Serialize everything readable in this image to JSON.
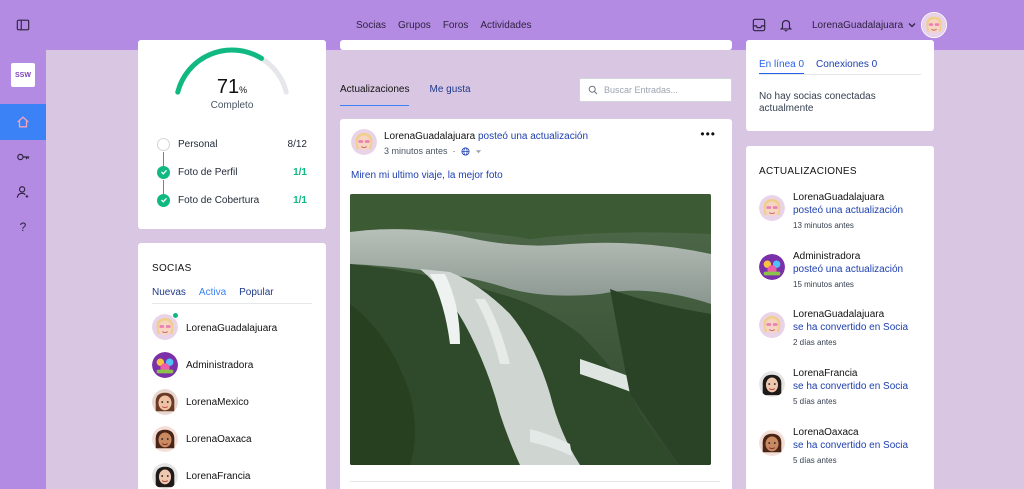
{
  "colors": {
    "accent": "#b48be3",
    "background": "#d9c6e3",
    "primary": "#3b82f6",
    "success": "#10b981"
  },
  "sidebar": {
    "logo_text": "SSW",
    "items": [
      {
        "icon": "sidebar-toggle-icon"
      },
      {
        "icon": "home-icon",
        "active": true
      },
      {
        "icon": "key-icon"
      },
      {
        "icon": "user-settings-icon"
      },
      {
        "icon": "help-icon",
        "text": "?"
      }
    ]
  },
  "topbar": {
    "nav": [
      "Socias",
      "Grupos",
      "Foros",
      "Actividades"
    ],
    "icons": [
      "inbox-icon",
      "bell-icon"
    ],
    "username": "LorenaGuadalajuara"
  },
  "profile_progress": {
    "percent": "71",
    "percent_sign": "%",
    "fraction": 0.71,
    "label": "Completo",
    "items": [
      {
        "label": "Personal",
        "count": "8/12",
        "done": false
      },
      {
        "label": "Foto de Perfil",
        "count": "1/1",
        "done": true
      },
      {
        "label": "Foto de Cobertura",
        "count": "1/1",
        "done": true
      }
    ]
  },
  "members": {
    "title": "SOCIAS",
    "tabs": [
      "Nuevas",
      "Activa",
      "Popular"
    ],
    "active_tab": "Activa",
    "list": [
      "LorenaGuadalajuara",
      "Administradora",
      "LorenaMexico",
      "LorenaOaxaca",
      "LorenaFrancia"
    ]
  },
  "feed": {
    "tabs": [
      "Actualizaciones",
      "Me gusta"
    ],
    "active_tab": "Actualizaciones",
    "search_placeholder": "Buscar Entradas...",
    "post": {
      "author": "LorenaGuadalajuara",
      "action": "posteó una actualización",
      "time": "3 minutos antes",
      "separator": "·",
      "more": "•••",
      "text": "Miren mi ultimo viaje, la mejor foto"
    }
  },
  "online": {
    "tabs": [
      "En línea 0",
      "Conexiones 0"
    ],
    "active_tab": "En línea 0",
    "empty": "No hay socias conectadas actualmente"
  },
  "updates": {
    "title": "ACTUALIZACIONES",
    "items": [
      {
        "name": "LorenaGuadalajuara",
        "action": "posteó una actualización",
        "time": "13 minutos antes"
      },
      {
        "name": "Administradora",
        "action": "posteó una actualización",
        "time": "15 minutos antes"
      },
      {
        "name": "LorenaGuadalajuara",
        "action": "se ha convertido en Socia",
        "time": "2 días antes"
      },
      {
        "name": "LorenaFrancia",
        "action": "se ha convertido en Socia",
        "time": "5 días antes"
      },
      {
        "name": "LorenaOaxaca",
        "action": "se ha convertido en Socia",
        "time": "5 días antes"
      }
    ]
  }
}
